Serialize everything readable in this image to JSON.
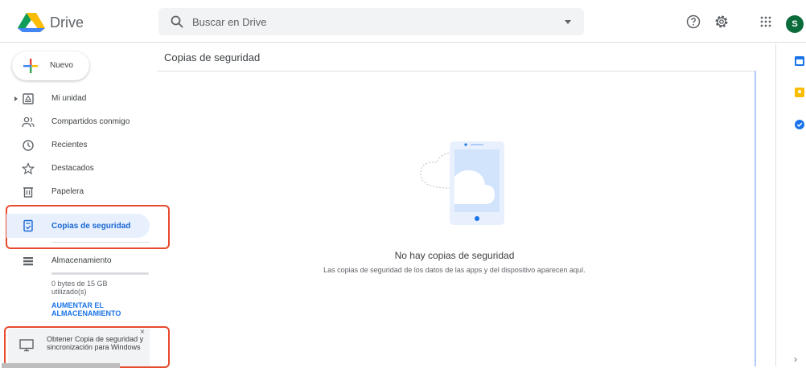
{
  "app": {
    "name": "Drive"
  },
  "search": {
    "placeholder": "Buscar en Drive"
  },
  "header": {
    "avatar_letter": "S"
  },
  "sidebar": {
    "new_label": "Nuevo",
    "items": [
      {
        "label": "Mi unidad"
      },
      {
        "label": "Compartidos conmigo"
      },
      {
        "label": "Recientes"
      },
      {
        "label": "Destacados"
      },
      {
        "label": "Papelera"
      },
      {
        "label": "Copias de seguridad"
      },
      {
        "label": "Almacenamiento"
      }
    ],
    "storage_text": "0 bytes de 15 GB utilizado(s)",
    "storage_used_fraction": 0,
    "upgrade_label": "AUMENTAR EL ALMACENAMIENTO",
    "promo_text": "Obtener Copia de seguridad y sincronización para Windows",
    "promo_close": "×"
  },
  "main": {
    "title": "Copias de seguridad",
    "empty_title": "No hay copias de seguridad",
    "empty_subtitle": "Las copias de seguridad de los datos de las apps y del dispositivo aparecen aquí."
  },
  "right_panel": {
    "chevron": "›"
  },
  "colors": {
    "accent": "#1a73e8",
    "active_bg": "#e8f0fe",
    "highlight": "#e84a2d",
    "avatar_bg": "#0b6b3a"
  }
}
